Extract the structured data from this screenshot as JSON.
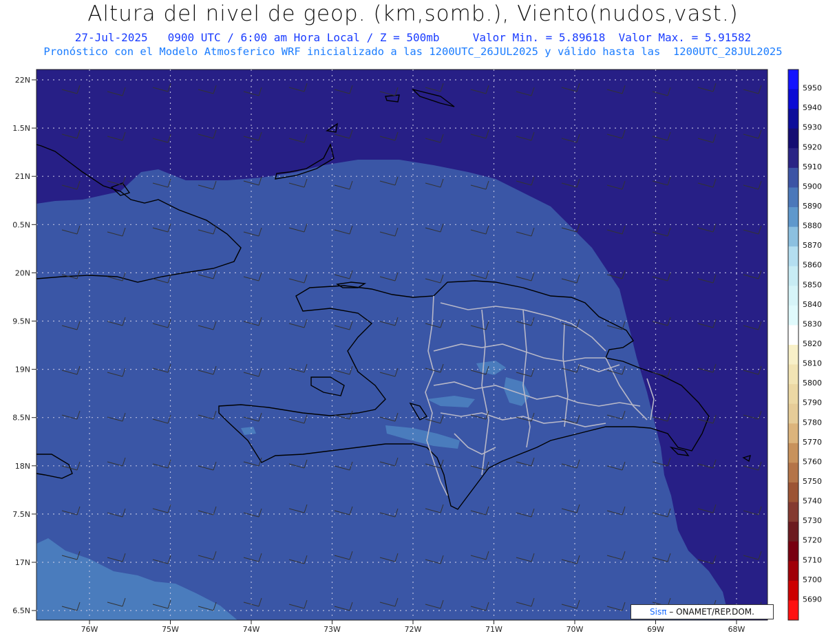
{
  "header": {
    "title": "Altura del nivel de geop. (km,somb.), Viento(nudos,vast.)",
    "line1": "27-Jul-2025   0900 UTC / 6:00 am Hora Local / Z = 500mb     Valor Min. = 5.89618  Valor Max. = 5.91582",
    "line2": "Pronóstico con el Modelo Atmosferico WRF inicializado a las 1200UTC_26JUL2025 y válido hasta las  1200UTC_28JUL2025"
  },
  "map": {
    "lat_labels": [
      "22N",
      "1.5N",
      "21N",
      "0.5N",
      "20N",
      "9.5N",
      "19N",
      "8.5N",
      "18N",
      "7.5N",
      "17N",
      "6.5N"
    ],
    "lon_labels": [
      "76W",
      "75W",
      "74W",
      "73W",
      "72W",
      "71W",
      "70W",
      "69W",
      "68W"
    ],
    "colors": {
      "deep": "#271f86",
      "mid": "#3a56a6",
      "light": "#4a7cbd"
    }
  },
  "colorbar": {
    "levels": [
      "5950",
      "5940",
      "5930",
      "5920",
      "5910",
      "5900",
      "5890",
      "5880",
      "5870",
      "5860",
      "5850",
      "5840",
      "5830",
      "5820",
      "5810",
      "5800",
      "5790",
      "5780",
      "5770",
      "5760",
      "5750",
      "5740",
      "5730",
      "5720",
      "5710",
      "5700",
      "5690"
    ],
    "colors": [
      "#1414ff",
      "#0a0ad4",
      "#0c0c9a",
      "#140c72",
      "#2a2485",
      "#3c54a5",
      "#4b78ba",
      "#5f98cc",
      "#8cc0e0",
      "#b4def0",
      "#c8ecf4",
      "#d6f4f8",
      "#e0fafc",
      "#ffffff",
      "#f8f0c8",
      "#f2e4b4",
      "#ecd8a4",
      "#e6cc98",
      "#dcb47c",
      "#c8925c",
      "#b47448",
      "#9c5434",
      "#843a30",
      "#6c1c20",
      "#780010",
      "#a00008",
      "#cc0000",
      "#ff1010"
    ]
  },
  "credit": {
    "brand": "Sisπ",
    "text": " – ONAMET/REP.DOM."
  }
}
